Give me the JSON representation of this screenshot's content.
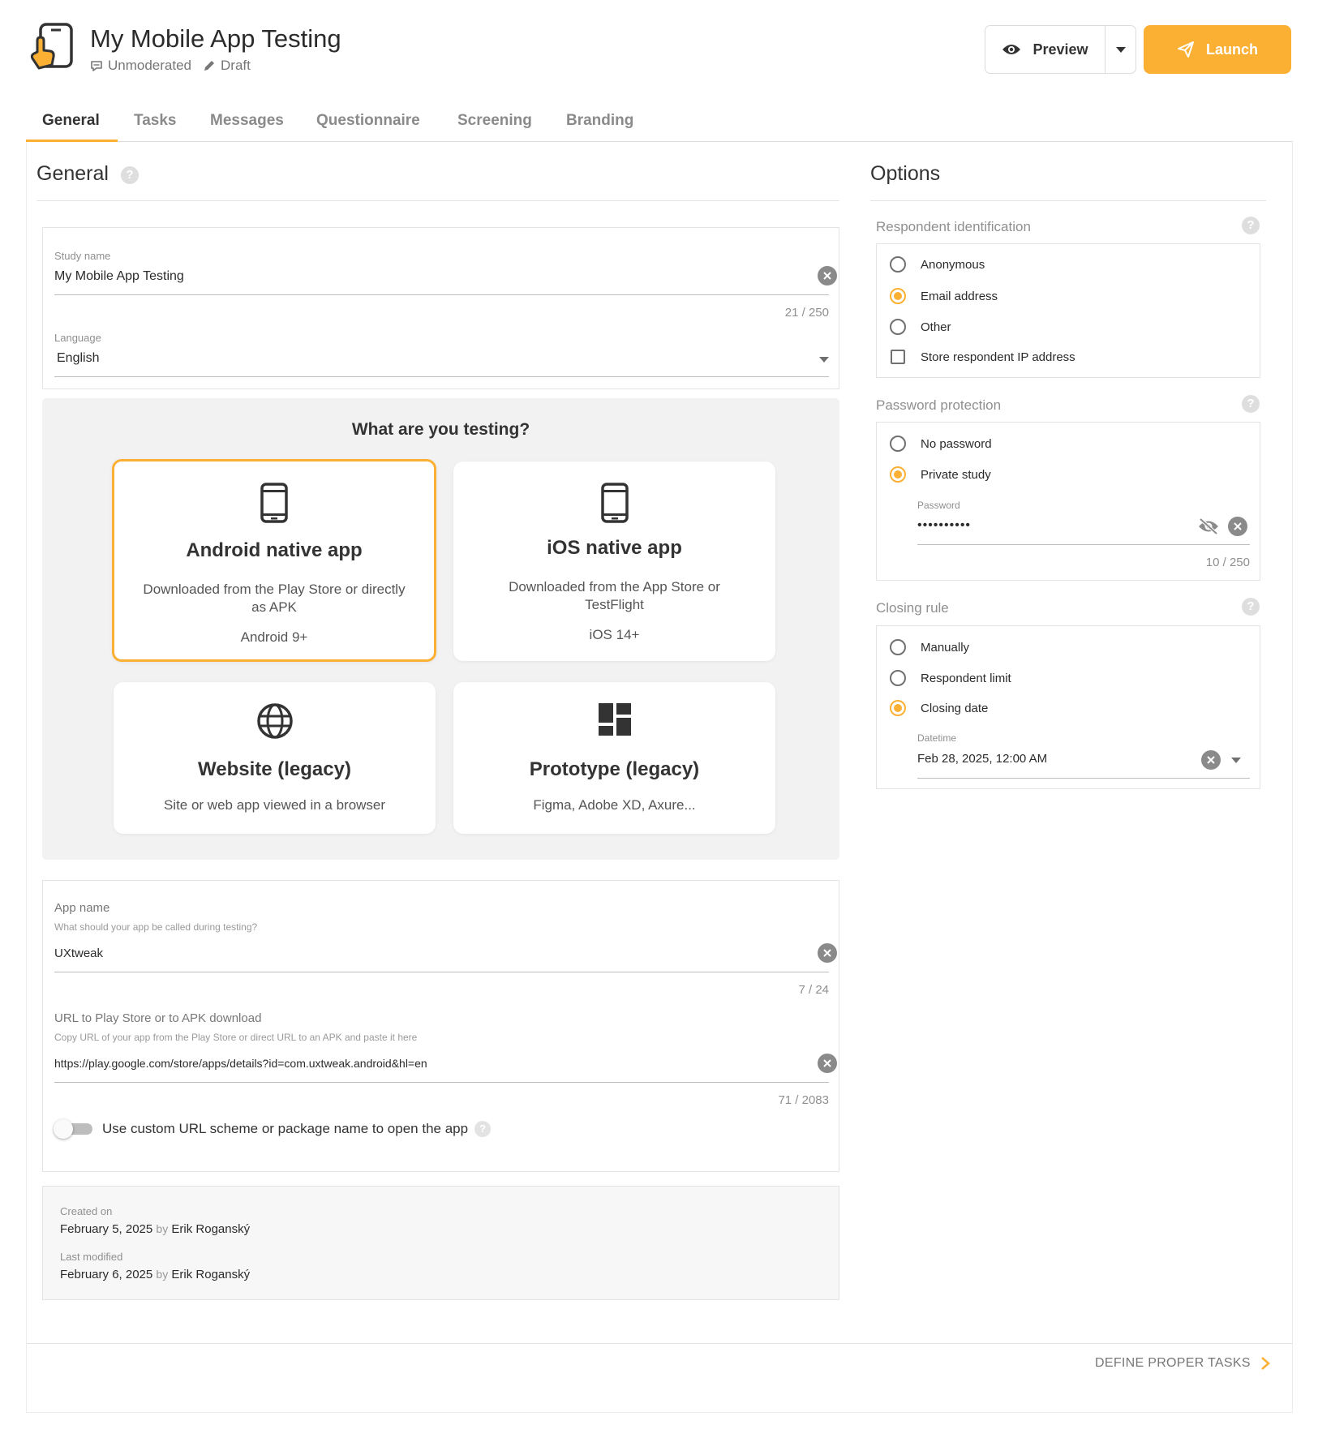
{
  "header": {
    "title": "My Mobile App Testing",
    "mode": "Unmoderated",
    "status": "Draft",
    "preview_label": "Preview",
    "launch_label": "Launch",
    "accent": "#fbb034"
  },
  "tabs": [
    {
      "label": "General"
    },
    {
      "label": "Tasks"
    },
    {
      "label": "Messages"
    },
    {
      "label": "Questionnaire"
    },
    {
      "label": "Screening"
    },
    {
      "label": "Branding"
    }
  ],
  "general": {
    "title": "General",
    "study_name": {
      "label": "Study name",
      "value": "My Mobile App Testing",
      "counter": "21 / 250"
    },
    "language": {
      "label": "Language",
      "value": "English"
    }
  },
  "testing": {
    "title": "What are you testing?",
    "options": [
      {
        "name": "Android native app",
        "desc_line1": "Downloaded from the Play Store or directly",
        "desc_line2": "as APK",
        "version": "Android 9+",
        "icon": "smartphone-icon"
      },
      {
        "name": "iOS native app",
        "desc_line1": "Downloaded from the App Store or",
        "desc_line2": "TestFlight",
        "version": "iOS 14+",
        "icon": "smartphone-icon"
      },
      {
        "name": "Website (legacy)",
        "desc_line1": "Site or web app viewed in a browser",
        "icon": "globe-icon"
      },
      {
        "name": "Prototype (legacy)",
        "desc_line1": "Figma, Adobe XD, Axure...",
        "icon": "dashboard-icon"
      }
    ]
  },
  "app": {
    "name_label": "App name",
    "name_hint": "What should your app be called during testing?",
    "name_value": "UXtweak",
    "name_counter": "7 / 24",
    "url_label": "URL to Play Store or to APK download",
    "url_hint": "Copy URL of your app from the Play Store or direct URL to an APK and paste it here",
    "url_value": "https://play.google.com/store/apps/details?id=com.uxtweak.android&hl=en",
    "url_counter": "71 / 2083",
    "custom_scheme_label": "Use custom URL scheme or package name to open the app"
  },
  "history": {
    "created_label": "Created on",
    "created_date": "February 5, 2025",
    "by": "by",
    "created_by": "Erik Roganský",
    "modified_label": "Last modified",
    "modified_date": "February 6, 2025",
    "modified_by": "Erik Roganský"
  },
  "options": {
    "title": "Options",
    "respondent": {
      "heading": "Respondent identification",
      "choices": [
        "Anonymous",
        "Email address",
        "Other"
      ],
      "selected": "Email address",
      "store_ip_label": "Store respondent IP address"
    },
    "password": {
      "heading": "Password protection",
      "choices": [
        "No password",
        "Private study"
      ],
      "selected": "Private study",
      "field_label": "Password",
      "masked_value": "••••••••••",
      "counter": "10 / 250"
    },
    "closing": {
      "heading": "Closing rule",
      "choices": [
        "Manually",
        "Respondent limit",
        "Closing date"
      ],
      "selected": "Closing date",
      "field_label": "Datetime",
      "value": "Feb 28, 2025, 12:00 AM"
    }
  },
  "footer": {
    "next_label": "DEFINE PROPER TASKS"
  }
}
